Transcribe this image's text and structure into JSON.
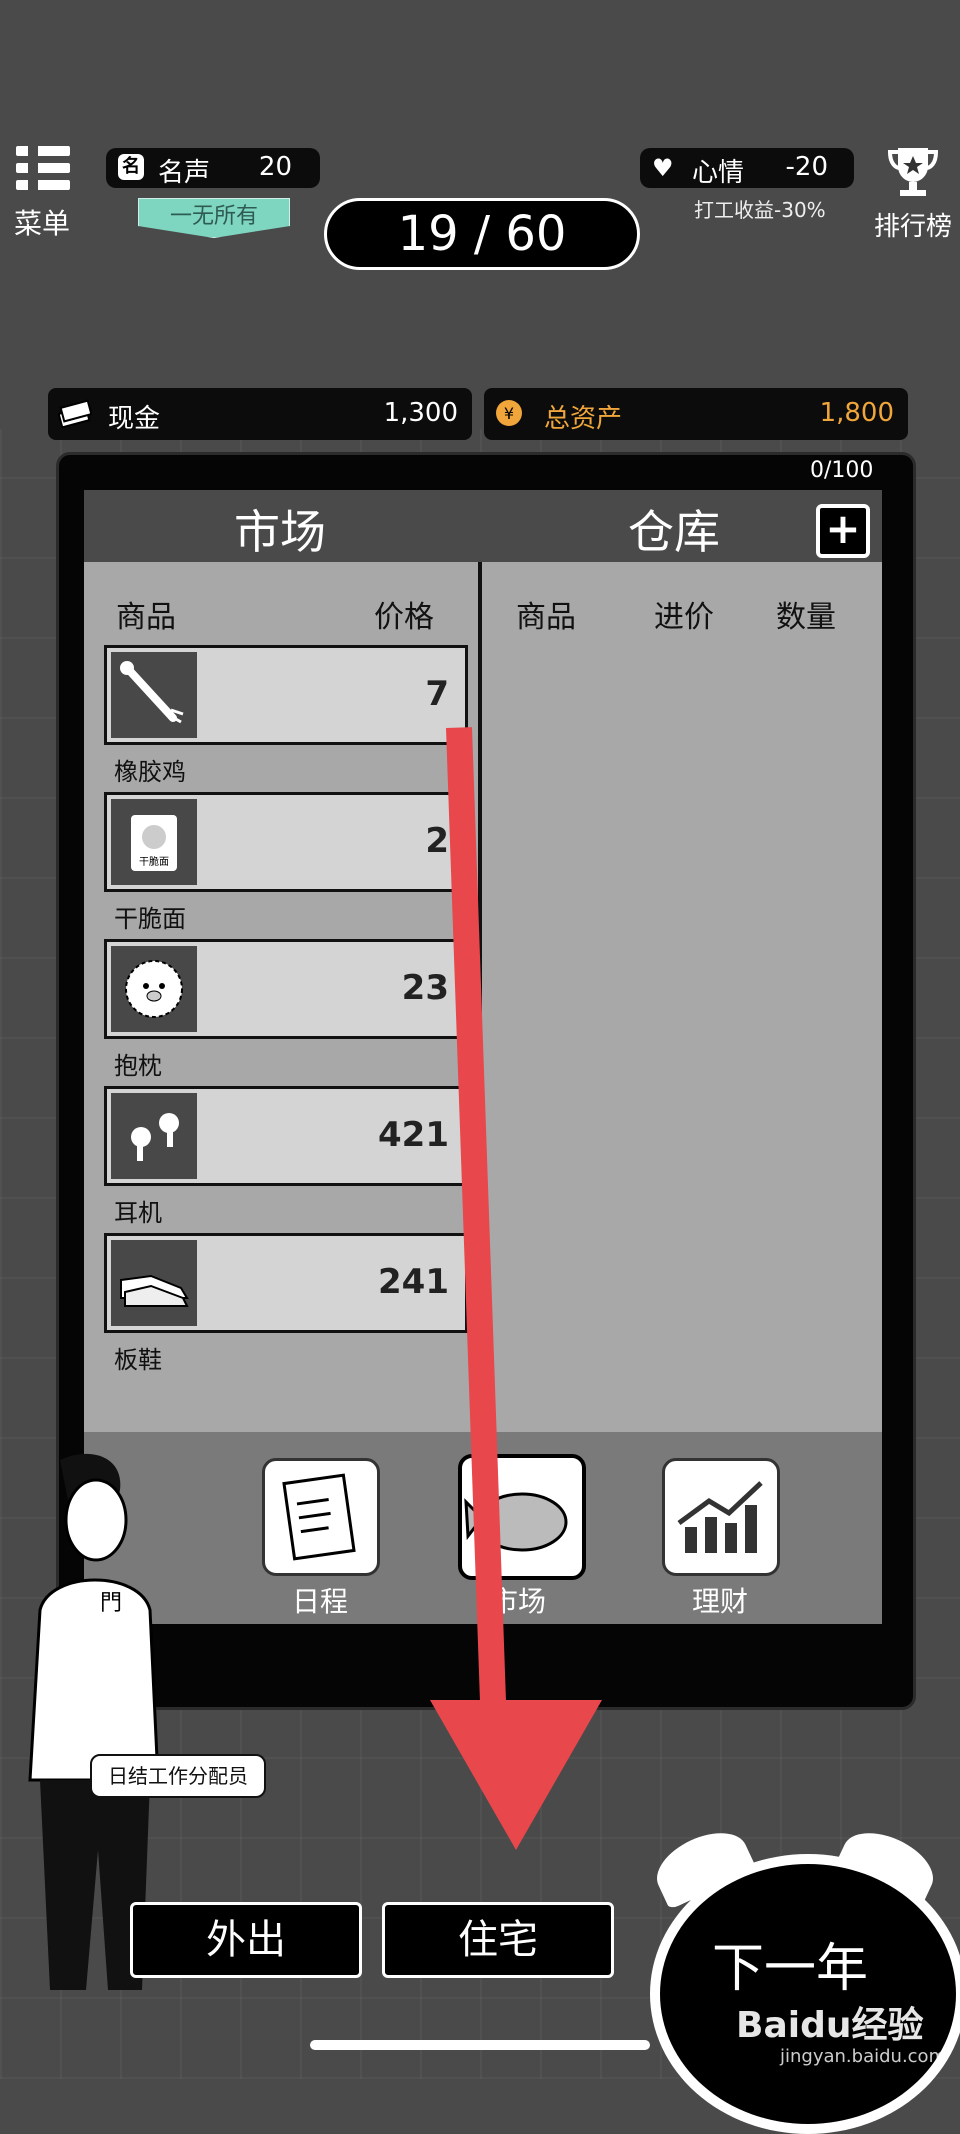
{
  "hud": {
    "menu_label": "菜单",
    "fame_label": "名声",
    "fame_icon_text": "名",
    "fame_value": "20",
    "title_badge": "一无所有",
    "turn": "19 / 60",
    "mood_label": "心情",
    "mood_value": "-20",
    "mood_effect": "打工收益-30%",
    "ranking_label": "排行榜"
  },
  "finance": {
    "cash_label": "现金",
    "cash_value": "1,300",
    "assets_label": "总资产",
    "assets_value": "1,800"
  },
  "panel": {
    "capacity": "0/100",
    "market_title": "市场",
    "warehouse_title": "仓库",
    "plus_label": "+",
    "market_headers": {
      "goods": "商品",
      "price": "价格"
    },
    "warehouse_headers": {
      "goods": "商品",
      "cost": "进价",
      "quantity": "数量"
    },
    "items": [
      {
        "name": "橡胶鸡",
        "price": "7",
        "icon": "rubber-chicken-icon"
      },
      {
        "name": "干脆面",
        "price": "2",
        "icon": "instant-noodle-icon"
      },
      {
        "name": "抱枕",
        "price": "23",
        "icon": "pillow-icon"
      },
      {
        "name": "耳机",
        "price": "421",
        "icon": "earbuds-icon"
      },
      {
        "name": "板鞋",
        "price": "241",
        "icon": "sneakers-icon"
      }
    ],
    "noodle_pack_text": "干脆面"
  },
  "nav": {
    "schedule": "日程",
    "market": "市场",
    "finance": "理财"
  },
  "bottom": {
    "go_out": "外出",
    "residence": "住宅",
    "next_year": "下一年",
    "job_tag": "日结工作分配员",
    "badge_on_shirt": "門"
  },
  "watermark": {
    "brand": "Baidu经验",
    "url": "jingyan.baidu.com"
  },
  "colors": {
    "background": "#4a4a4a",
    "badge": "#7fd6c0",
    "assets_accent": "#f0a63a",
    "arrow": "#e8474c"
  }
}
